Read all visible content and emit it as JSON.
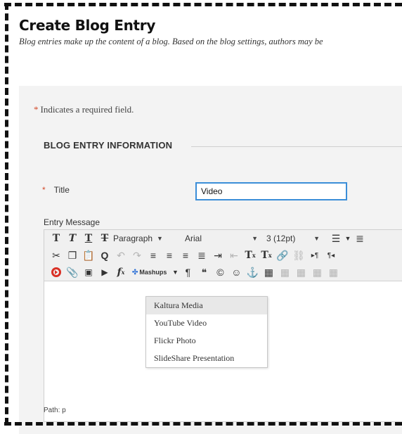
{
  "header": {
    "title": "Create Blog Entry",
    "description": "Blog entries make up the content of a blog. Based on the blog settings, authors may be"
  },
  "form": {
    "required_star": "*",
    "required_note": "Indicates a required field.",
    "section_title": "BLOG ENTRY INFORMATION",
    "title_label": "Title",
    "title_value": "Video",
    "entry_label": "Entry Message"
  },
  "editor": {
    "paragraph_select": "Paragraph",
    "font_select": "Arial",
    "size_select": "3 (12pt)",
    "mashups_label": "Mashups",
    "path": "Path: p"
  },
  "mashups_menu": {
    "items": [
      "Kaltura Media",
      "YouTube Video",
      "Flickr Photo",
      "SlideShare Presentation"
    ],
    "highlighted": "Kaltura Media"
  },
  "colors": {
    "accent": "#3b8ed8",
    "required": "#d34b2b",
    "mashup_icon_red": "#d93025"
  },
  "icons": {
    "row1": [
      "bold-icon",
      "italic-icon",
      "underline-icon",
      "strikethrough-icon",
      "bullet-list-icon",
      "numbered-list-icon"
    ],
    "row2": [
      "cut-icon",
      "copy-icon",
      "paste-icon",
      "find-icon",
      "undo-icon",
      "redo-icon",
      "align-left-icon",
      "align-center-icon",
      "align-right-icon",
      "justify-icon",
      "indent-icon",
      "outdent-icon",
      "superscript-icon",
      "subscript-icon",
      "link-icon",
      "unlink-icon",
      "ltr-icon",
      "rtl-icon"
    ],
    "row3": [
      "mashup-record-icon",
      "attach-icon",
      "image-icon",
      "media-icon",
      "formula-icon",
      "paragraph-mark-icon",
      "blockquote-icon",
      "copyright-icon",
      "emoji-icon",
      "anchor-icon",
      "table-icon"
    ]
  }
}
